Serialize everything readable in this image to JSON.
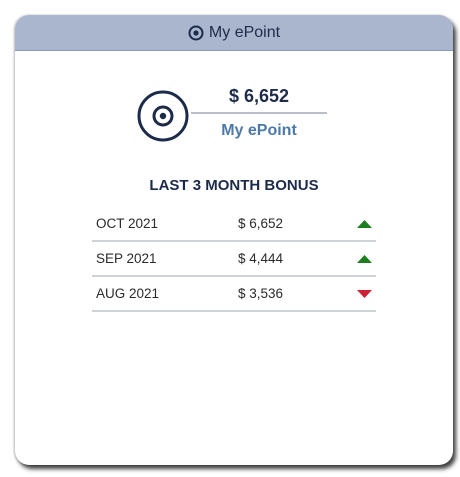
{
  "header": {
    "title": "My ePoint",
    "icon": "target-icon"
  },
  "summary": {
    "icon": "target-icon",
    "amount": "$ 6,652",
    "label": "My ePoint"
  },
  "bonus": {
    "title": "LAST 3 MONTH BONUS",
    "rows": [
      {
        "month": "OCT 2021",
        "value": "$ 6,652",
        "trend": "up"
      },
      {
        "month": "SEP 2021",
        "value": "$ 4,444",
        "trend": "up"
      },
      {
        "month": "AUG 2021",
        "value": "$ 3,536",
        "trend": "down"
      }
    ]
  },
  "colors": {
    "header_bg": "#aab6cd",
    "navy": "#1d2b4a",
    "accent_blue": "#4d79a8",
    "trend_up": "#1e7d1e",
    "trend_down": "#cc2233"
  }
}
